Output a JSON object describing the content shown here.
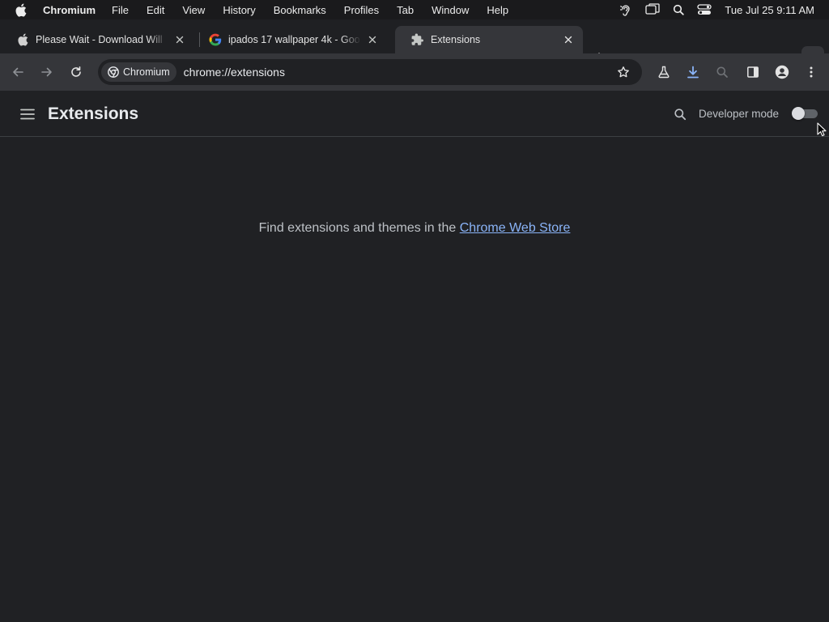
{
  "menubar": {
    "app_name": "Chromium",
    "items": [
      "File",
      "Edit",
      "View",
      "History",
      "Bookmarks",
      "Profiles",
      "Tab",
      "Window",
      "Help"
    ],
    "clock": "Tue Jul 25  9:11 AM"
  },
  "tabs": [
    {
      "title": "Please Wait - Download Will",
      "favicon": "apple-icon",
      "active": false
    },
    {
      "title": "ipados 17 wallpaper 4k - Goo",
      "favicon": "google-icon",
      "active": false
    },
    {
      "title": "Extensions",
      "favicon": "puzzle-icon",
      "active": true
    }
  ],
  "omnibox": {
    "chip_label": "Chromium",
    "url": "chrome://extensions"
  },
  "page": {
    "title": "Extensions",
    "developer_mode_label": "Developer mode",
    "developer_mode_on": false,
    "empty_text": "Find extensions and themes in the ",
    "store_link": "Chrome Web Store"
  },
  "colors": {
    "page_bg": "#202124",
    "toolbar_bg": "#35363a",
    "link": "#8ab4f8"
  }
}
